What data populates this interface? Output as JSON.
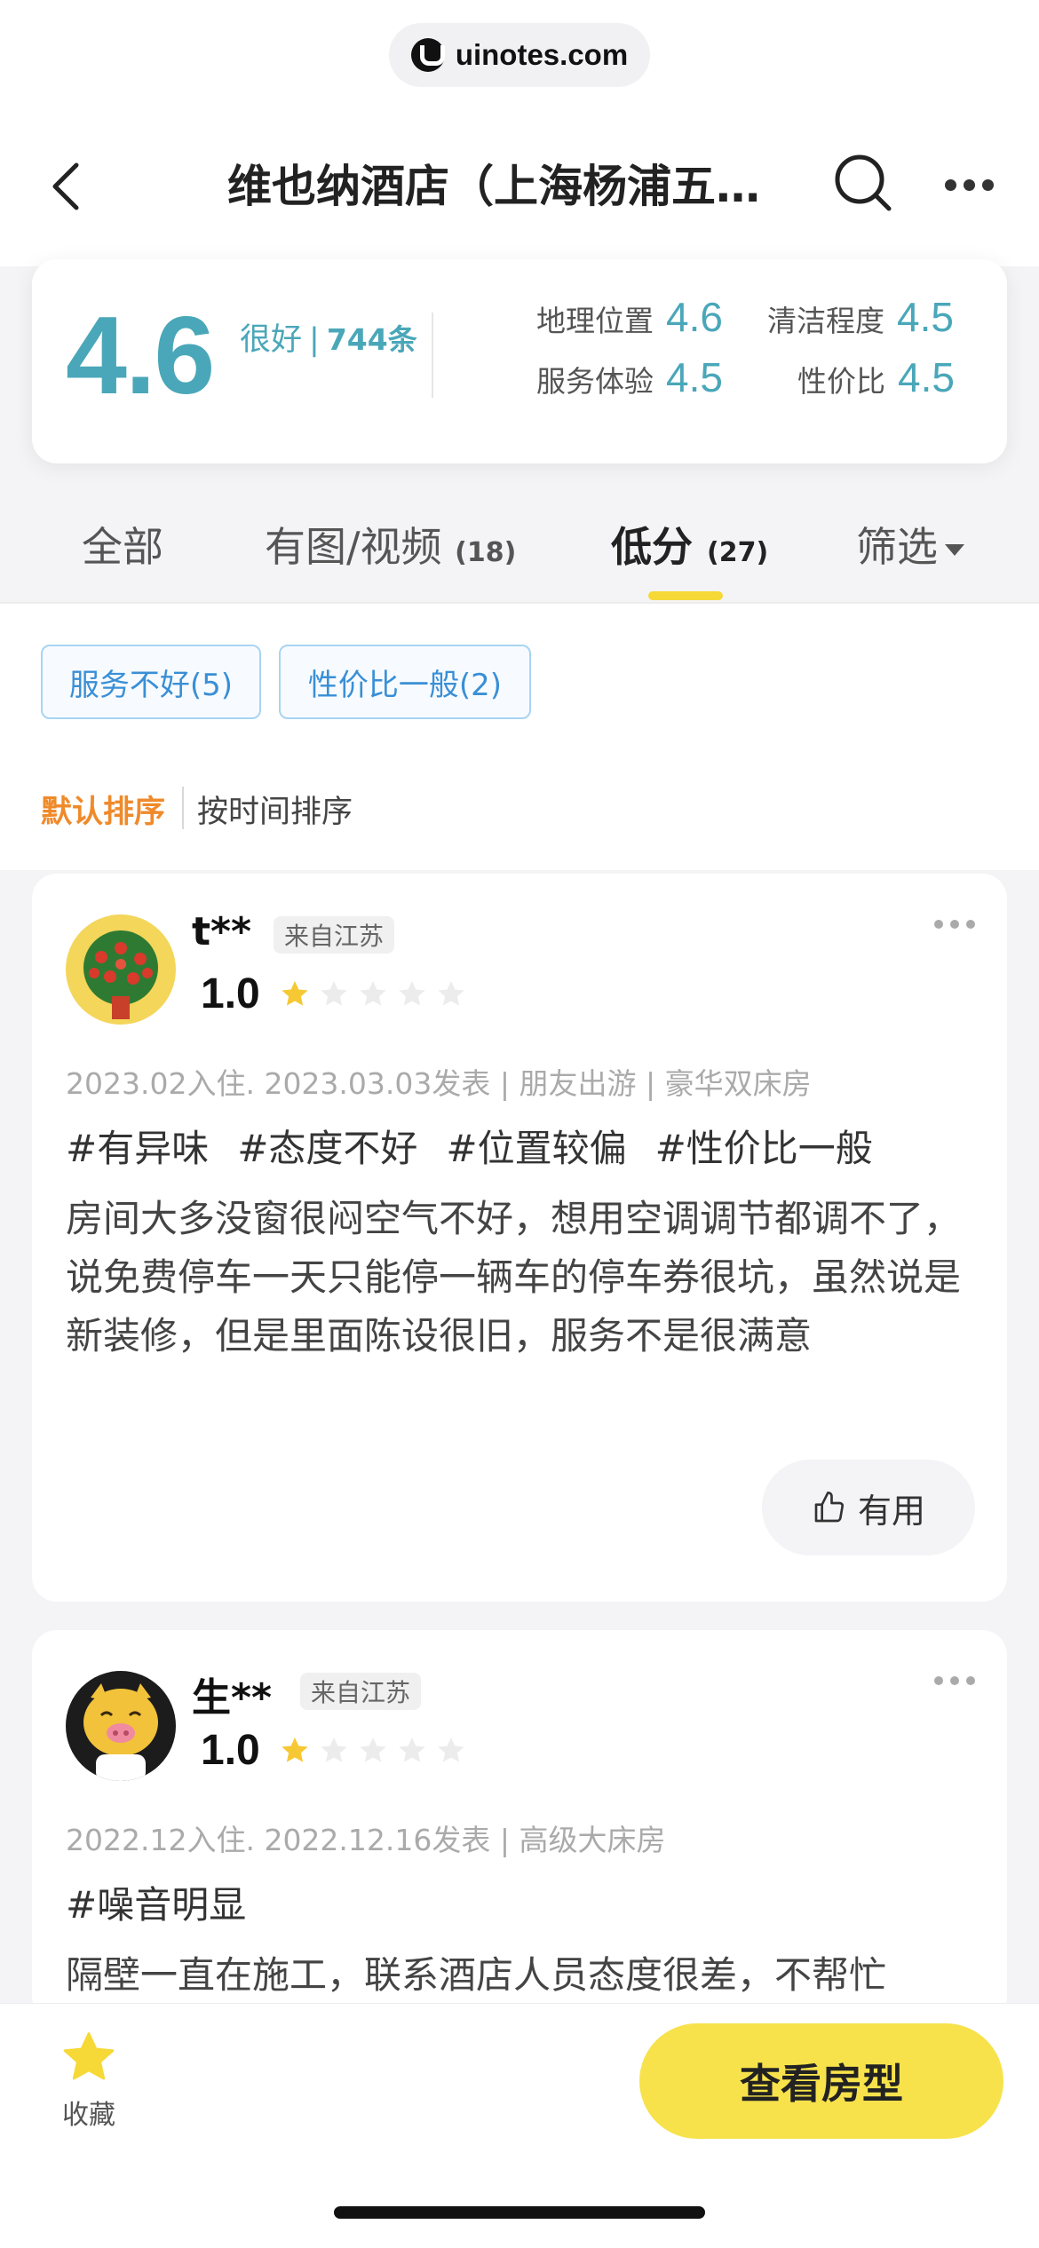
{
  "watermark": {
    "text": "uinotes.com"
  },
  "nav": {
    "title": "维也纳酒店（上海杨浦五…"
  },
  "rating": {
    "score": "4.6",
    "label": "很好",
    "separator": "|",
    "count": "744条",
    "sub": [
      {
        "label": "地理位置",
        "value": "4.6"
      },
      {
        "label": "清洁程度",
        "value": "4.5"
      },
      {
        "label": "服务体验",
        "value": "4.5"
      },
      {
        "label": "性价比",
        "value": "4.5"
      }
    ]
  },
  "tabs": [
    {
      "label": "全部",
      "count": ""
    },
    {
      "label": "有图/视频",
      "count": "(18)"
    },
    {
      "label": "低分",
      "count": "(27)"
    },
    {
      "label": "筛选",
      "count": ""
    }
  ],
  "active_tab": "低分",
  "filter_chips": [
    "服务不好(5)",
    "性价比一般(2)"
  ],
  "sort": {
    "default": "默认排序",
    "by_time": "按时间排序"
  },
  "reviews": [
    {
      "user": "t**",
      "from": "来自江苏",
      "score": "1.0",
      "stars": 1,
      "meta": "2023.02入住. 2023.03.03发表 | 朋友出游 | 豪华双床房",
      "tags": [
        "#有异味",
        "#态度不好",
        "#位置较偏",
        "#性价比一般"
      ],
      "content": "房间大多没窗很闷空气不好，想用空调调节都调不了，说免费停车一天只能停一辆车的停车券很坑，虽然说是新装修，但是里面陈设很旧，服务不是很满意",
      "useful_label": "有用"
    },
    {
      "user": "生**",
      "from": "来自江苏",
      "score": "1.0",
      "stars": 1,
      "meta": "2022.12入住. 2022.12.16发表 | 高级大床房",
      "tags": [
        "#噪音明显"
      ],
      "content": "隔壁一直在施工，联系酒店人员态度很差，不帮忙"
    }
  ],
  "bottom": {
    "fav_label": "收藏",
    "cta_label": "查看房型"
  },
  "colors": {
    "accent": "#4aa7b9",
    "star": "#f6c833",
    "cta": "#f7e24b",
    "sort_active": "#ef8a2b",
    "chip": "#3a8fd6"
  }
}
